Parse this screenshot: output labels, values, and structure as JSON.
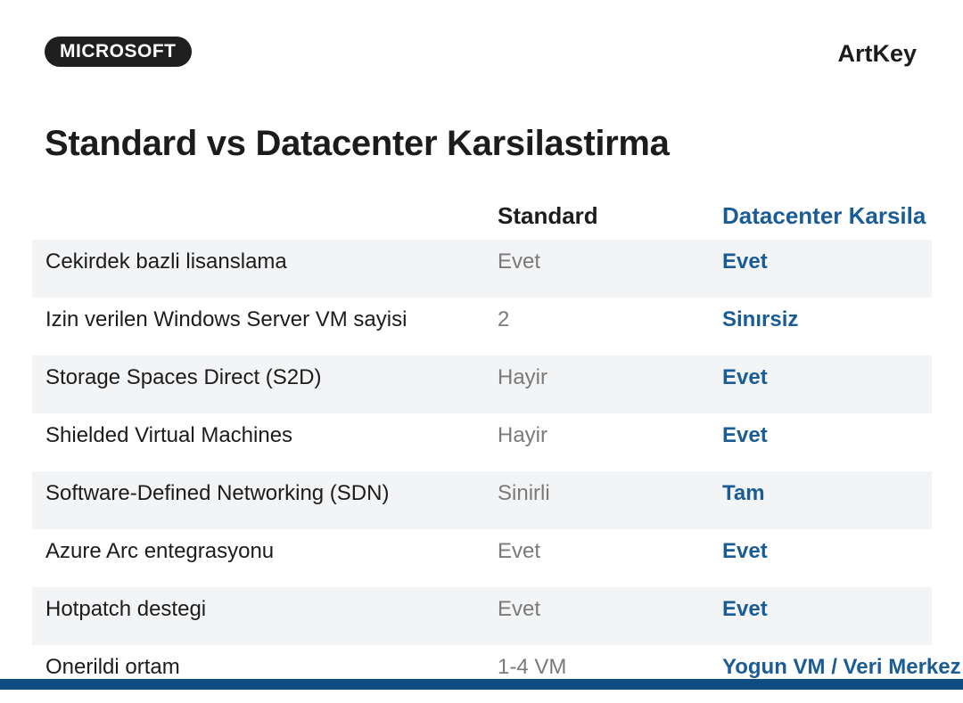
{
  "header": {
    "badge": "MICROSOFT",
    "brand": "ArtKey"
  },
  "title": "Standard vs Datacenter Karsilastirma",
  "table": {
    "columns": {
      "standard": "Standard",
      "datacenter": "Datacenter Karsila"
    },
    "rows": [
      {
        "feature": "Cekirdek bazli lisanslama",
        "standard": "Evet",
        "datacenter": "Evet"
      },
      {
        "feature": "Izin verilen Windows Server VM sayisi",
        "standard": "2",
        "datacenter": "Sinırsiz"
      },
      {
        "feature": "Storage Spaces Direct (S2D)",
        "standard": "Hayir",
        "datacenter": "Evet"
      },
      {
        "feature": "Shielded Virtual Machines",
        "standard": "Hayir",
        "datacenter": "Evet"
      },
      {
        "feature": "Software-Defined Networking (SDN)",
        "standard": "Sinirli",
        "datacenter": "Tam"
      },
      {
        "feature": "Azure Arc entegrasyonu",
        "standard": "Evet",
        "datacenter": "Evet"
      },
      {
        "feature": "Hotpatch destegi",
        "standard": "Evet",
        "datacenter": "Evet"
      },
      {
        "feature": "Onerildi ortam",
        "standard": "1-4 VM",
        "datacenter": "Yogun VM / Veri Merkez"
      }
    ]
  },
  "colors": {
    "accent": "#1a5c96",
    "footer": "#0f4c81",
    "badge_bg": "#1f1f1f",
    "row_shade": "#f3f4f6"
  }
}
